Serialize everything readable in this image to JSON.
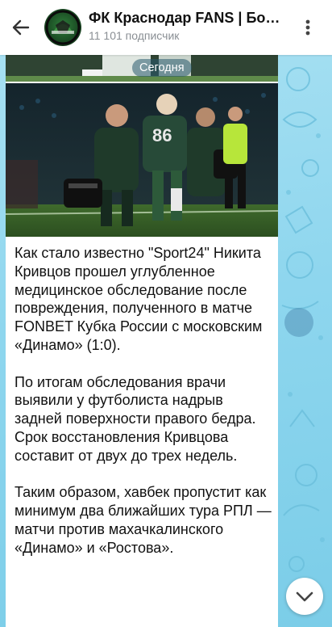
{
  "header": {
    "title": "ФК Краснодар FANS | Бо…",
    "subscribers": "11 101 подписчик"
  },
  "post": {
    "date_label": "Сегодня",
    "paragraphs": [
      "Как стало известно \"Sport24\" Никита Кривцов прошел углубленное медицинское обследование после повреждения, полученного в матче FONBET Кубка России с московским «Динамо» (1:0).",
      "По итогам обследования врачи выявили у футболиста надрыв задней поверхности правого бедра. Срок восстановления Кривцова составит от двух до трех недель.",
      "Таким образом, хавбек пропустит как минимум два ближайших тура РПЛ — матчи против махачкалинского «Динамо» и «Ростова»."
    ],
    "photo_jersey_number": "86"
  },
  "icons": {
    "back": "arrow-left-icon",
    "menu": "more-vertical-icon",
    "scroll_down": "chevron-down-icon"
  },
  "colors": {
    "chat_background": "#8ed6ee",
    "header_background": "#ffffff",
    "date_pill": "#285a6e"
  }
}
